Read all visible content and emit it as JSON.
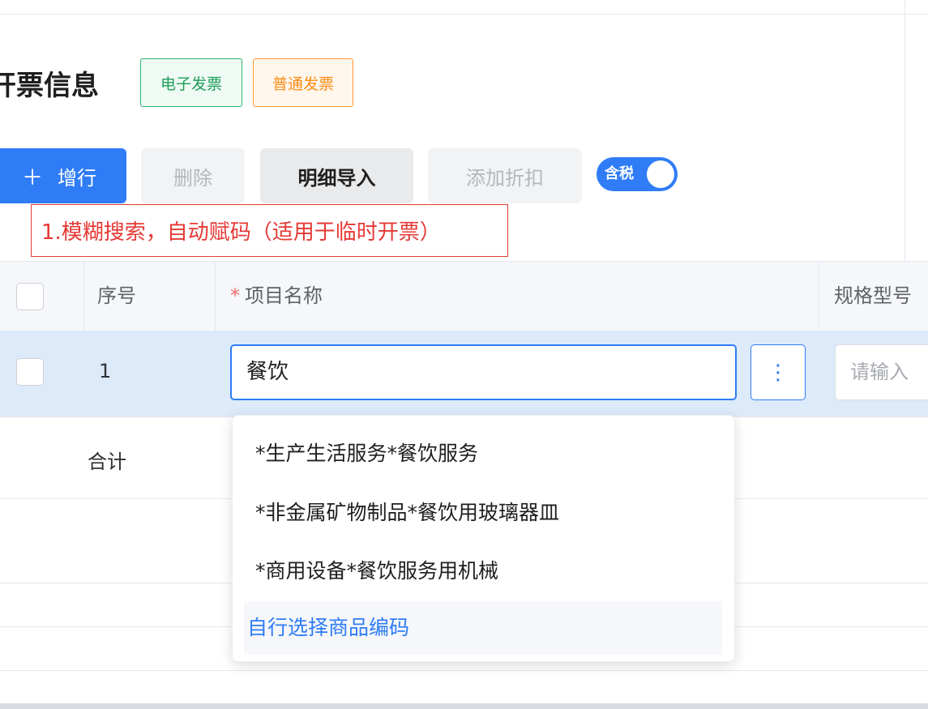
{
  "header": {
    "title": "开票信息",
    "tags": [
      "电子发票",
      "普通发票"
    ]
  },
  "toolbar": {
    "add_icon": "＋",
    "add_label": "增行",
    "delete_label": "删除",
    "import_label": "明细导入",
    "discount_label": "添加折扣",
    "tax_toggle_label": "含税",
    "tax_toggle_on": true
  },
  "annotation": "1.模糊搜索，自动赋码（适用于临时开票）",
  "table": {
    "columns": {
      "index": "序号",
      "required_mark": "*",
      "name": "项目名称",
      "spec": "规格型号"
    },
    "row": {
      "index": "1",
      "name_value": "餐饮",
      "more_icon": "⋮",
      "spec_placeholder": "请输入"
    },
    "total_label": "合计"
  },
  "dropdown": {
    "options": [
      "*生产生活服务*餐饮服务",
      "*非金属矿物制品*餐饮用玻璃器皿",
      "*商用设备*餐饮服务用机械"
    ],
    "custom_option": "自行选择商品编码"
  },
  "colors": {
    "primary": "#2f7cf6",
    "row_highlight": "#dceafa",
    "annotation_red": "#e53935",
    "tag_green": "#1f9d5a",
    "tag_orange": "#fa8c16"
  }
}
